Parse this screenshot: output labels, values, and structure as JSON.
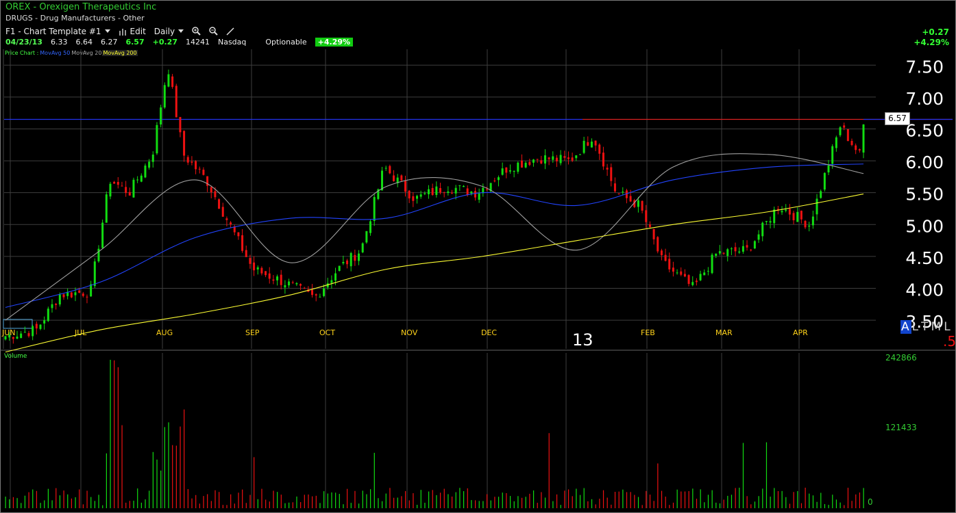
{
  "header": {
    "title": "OREX -  Orexigen Therapeutics Inc",
    "sector": "DRUGS - Drug Manufacturers - Other"
  },
  "toolbar": {
    "template_label": "F1 - Chart Template #1",
    "edit_label": "Edit",
    "period_label": "Daily"
  },
  "quote": {
    "date": "04/23/13",
    "open": "6.33",
    "high": "6.64",
    "low": "6.27",
    "close": "6.57",
    "change": "+0.27",
    "volume": "14241",
    "exchange": "Nasdaq",
    "optionable": "Optionable",
    "change_pct_badge": "+4.29%"
  },
  "change_panel": {
    "change": "+0.27",
    "change_pct": "+4.29%"
  },
  "legend": {
    "main": "Price Chart :",
    "ma50": "MovAvg 50",
    "ma20": "MovAvg 20",
    "ma200": "MovAvg 200"
  },
  "volume_panel": {
    "label": "Volume",
    "ticks": [
      "242866",
      "121433",
      "0"
    ]
  },
  "timeframe": {
    "options": [
      "A",
      "L",
      "T",
      "M",
      "L"
    ],
    "selected": "A",
    "suffix": ".5"
  },
  "current_price_badge": "6.57",
  "year_marker": "13",
  "colors": {
    "up": "#11dd11",
    "down": "#ee1111",
    "ma50": "#2244ff",
    "ma20": "#a0a0a0",
    "ma200": "#ffff33",
    "hline_blue": "#2233ee",
    "hline_red": "#dd2222",
    "grid": "#3e3e3e"
  },
  "chart_data": {
    "type": "line",
    "title": "",
    "xlabel": "",
    "ylabel": "",
    "ylim": [
      3.05,
      7.75
    ],
    "grid": true,
    "y_ticks": [
      "7.50",
      "7.00",
      "6.50",
      "6.00",
      "5.50",
      "5.00",
      "4.50",
      "4.00",
      "3.50"
    ],
    "month_labels": [
      "JUN",
      "JUL",
      "AUG",
      "SEP",
      "OCT",
      "NOV",
      "DEC",
      "FEB",
      "MAR",
      "APR"
    ],
    "resistance_level": 6.65,
    "series": [
      {
        "name": "Price Chart",
        "x": [
          "JUN",
          "JUL",
          "AUG",
          "SEP",
          "OCT",
          "NOV",
          "DEC",
          "FEB",
          "MAR",
          "APR"
        ],
        "values": [
          3.3,
          5.8,
          4.3,
          5.3,
          5.9,
          4.3,
          4.9,
          5.9,
          6.1,
          6.57
        ]
      },
      {
        "name": "MovAvg 50",
        "values": [
          3.7,
          4.1,
          4.8,
          5.1,
          5.1,
          5.5,
          5.3,
          5.7,
          5.9,
          5.95
        ]
      },
      {
        "name": "MovAvg 20",
        "values": [
          3.5,
          4.6,
          5.7,
          4.4,
          5.6,
          5.6,
          4.6,
          5.9,
          6.1,
          5.8
        ]
      },
      {
        "name": "MovAvg 200",
        "values": [
          3.0,
          3.35,
          3.6,
          3.9,
          4.3,
          4.5,
          4.75,
          5.0,
          5.2,
          5.48
        ]
      }
    ]
  }
}
